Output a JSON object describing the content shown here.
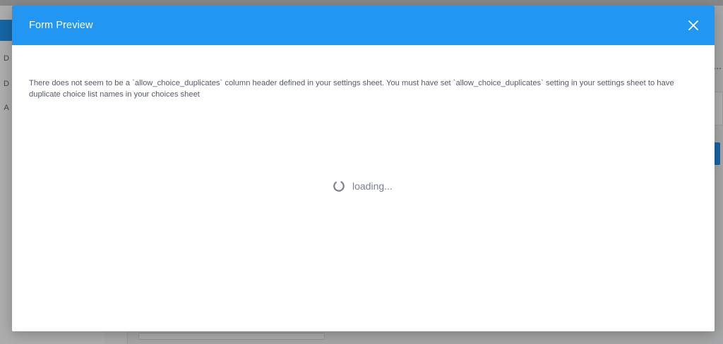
{
  "modal": {
    "title": "Form Preview",
    "message": "There does not seem to be a `allow_choice_duplicates` column header defined in your settings sheet. You must have set `allow_choice_duplicates` setting in your settings sheet to have duplicate choice list names in your choices sheet",
    "loading_text": "loading...",
    "close_icon": "close-icon",
    "spinner_icon": "spinner-icon"
  },
  "background": {
    "sidebar_items": [
      "D",
      "D",
      "A"
    ]
  },
  "colors": {
    "header": "#2196f3",
    "overlay": "rgba(0,0,0,0.32)",
    "text": "#555a6b",
    "spinner": "#7a7f8f"
  }
}
